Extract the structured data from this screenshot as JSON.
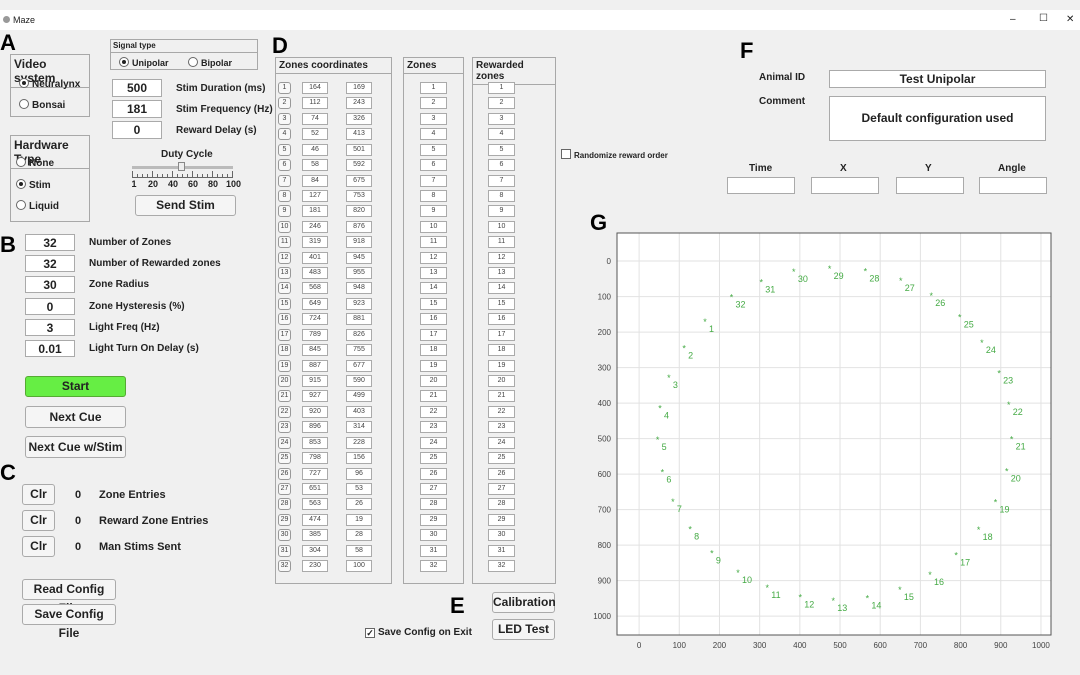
{
  "window": {
    "title": "Maze",
    "minimize": "–",
    "maximize": "☐",
    "close": "✕"
  },
  "section_labels": {
    "a": "A",
    "b": "B",
    "c": "C",
    "d": "D",
    "e": "E",
    "f": "F",
    "g": "G"
  },
  "video_system": {
    "title": "Video system",
    "options": [
      {
        "label": "Neuralynx",
        "selected": true
      },
      {
        "label": "Bonsai",
        "selected": false
      }
    ]
  },
  "hardware_type": {
    "title": "Hardware Type",
    "options": [
      {
        "label": "None",
        "selected": false
      },
      {
        "label": "Stim",
        "selected": true
      },
      {
        "label": "Liquid",
        "selected": false
      }
    ]
  },
  "signal_type": {
    "title": "Signal type",
    "options": [
      {
        "label": "Unipolar",
        "selected": true
      },
      {
        "label": "Bipolar",
        "selected": false
      }
    ]
  },
  "stim": {
    "duration": {
      "value": "500",
      "label": "Stim Duration (ms)"
    },
    "frequency": {
      "value": "181",
      "label": "Stim Frequency (Hz)"
    },
    "reward_delay": {
      "value": "0",
      "label": "Reward Delay (s)"
    }
  },
  "duty_cycle": {
    "label": "Duty Cycle",
    "value": 50,
    "ticks": [
      "1",
      "20",
      "40",
      "60",
      "80",
      "100"
    ],
    "send_label": "Send Stim"
  },
  "params": [
    {
      "value": "32",
      "label": "Number of Zones"
    },
    {
      "value": "32",
      "label": "Number of Rewarded zones"
    },
    {
      "value": "30",
      "label": "Zone Radius"
    },
    {
      "value": "0",
      "label": "Zone Hysteresis (%)"
    },
    {
      "value": "3",
      "label": "Light Freq (Hz)"
    },
    {
      "value": "0.01",
      "label": "Light Turn On Delay (s)"
    }
  ],
  "buttons": {
    "start": "Start",
    "next_cue": "Next Cue",
    "next_cue_stim": "Next Cue w/Stim",
    "read_config": "Read Config File",
    "save_config": "Save Config File",
    "calibration": "Calibration",
    "led_test": "LED Test",
    "start_color": "#66ee44"
  },
  "counters": [
    {
      "clear": "Clr",
      "value": "0",
      "label": "Zone Entries"
    },
    {
      "clear": "Clr",
      "value": "0",
      "label": "Reward Zone Entries"
    },
    {
      "clear": "Clr",
      "value": "0",
      "label": "Man Stims Sent"
    }
  ],
  "save_on_exit": {
    "label": "Save Config on Exit",
    "checked": true
  },
  "randomize": {
    "label": "Randomize reward order",
    "checked": false
  },
  "zones_coordinates": {
    "title": "Zones coordinates",
    "rows": [
      [
        164,
        169
      ],
      [
        112,
        243
      ],
      [
        74,
        326
      ],
      [
        52,
        413
      ],
      [
        46,
        501
      ],
      [
        58,
        592
      ],
      [
        84,
        675
      ],
      [
        127,
        753
      ],
      [
        181,
        820
      ],
      [
        246,
        876
      ],
      [
        319,
        918
      ],
      [
        401,
        945
      ],
      [
        483,
        955
      ],
      [
        568,
        948
      ],
      [
        649,
        923
      ],
      [
        724,
        881
      ],
      [
        789,
        826
      ],
      [
        845,
        755
      ],
      [
        887,
        677
      ],
      [
        915,
        590
      ],
      [
        927,
        499
      ],
      [
        920,
        403
      ],
      [
        896,
        314
      ],
      [
        853,
        228
      ],
      [
        798,
        156
      ],
      [
        727,
        96
      ],
      [
        651,
        53
      ],
      [
        563,
        26
      ],
      [
        474,
        19
      ],
      [
        385,
        28
      ],
      [
        304,
        58
      ],
      [
        230,
        100
      ]
    ]
  },
  "zones": {
    "title": "Zones"
  },
  "rewarded_zones": {
    "title": "Rewarded zones"
  },
  "animal": {
    "id_label": "Animal ID",
    "id_value": "Test Unipolar",
    "comment_label": "Comment",
    "comment_value": "Default configuration used"
  },
  "tracking": {
    "time_label": "Time",
    "x_label": "X",
    "y_label": "Y",
    "angle_label": "Angle",
    "time": "",
    "x": "",
    "y": "",
    "angle": ""
  },
  "chart_data": {
    "type": "scatter",
    "marker": "*",
    "color": "#44aa44",
    "xlim": [
      -55,
      1025
    ],
    "ylim": [
      1053,
      -79
    ],
    "y_reversed": true,
    "grid": true,
    "xticks": [
      0,
      100,
      200,
      300,
      400,
      500,
      600,
      700,
      800,
      900,
      1000
    ],
    "yticks": [
      0,
      100,
      200,
      300,
      400,
      500,
      600,
      700,
      800,
      900,
      1000
    ],
    "point_labels": "zone numbers 1-32",
    "source": "zones_coordinates.rows"
  }
}
